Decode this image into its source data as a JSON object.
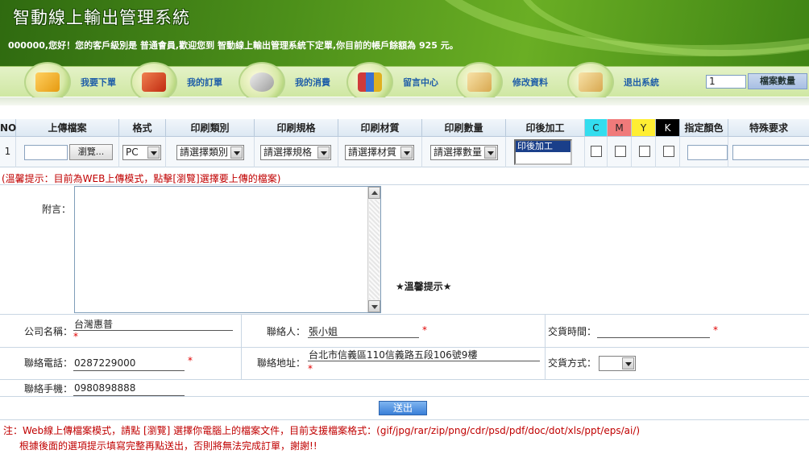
{
  "header": {
    "title": "智動線上輸出管理系統",
    "welcome": "000000,您好！您的客戶級別是 普通會員,歡迎您到 智動線上輸出管理系統下定單,你目前的帳戶餘額為 925 元。"
  },
  "nav": {
    "items": [
      {
        "label": "我要下單",
        "icon": "folder-icon",
        "color": "#f0b030"
      },
      {
        "label": "我的訂單",
        "icon": "orders-icon",
        "color": "#e0552a"
      },
      {
        "label": "我的消費",
        "icon": "gear-folder-icon",
        "color": "#c8c8c8"
      },
      {
        "label": "留言中心",
        "icon": "books-icon",
        "color": "#d04040"
      },
      {
        "label": "修改資料",
        "icon": "edit-folder-icon",
        "color": "#e8c878"
      },
      {
        "label": "退出系統",
        "icon": "exit-folder-icon",
        "color": "#e8c878"
      }
    ],
    "file_count_value": "1",
    "file_count_label": "檔案數量"
  },
  "order_table": {
    "headers": [
      "NO",
      "上傳檔案",
      "格式",
      "印刷類別",
      "印刷規格",
      "印刷材質",
      "印刷數量",
      "印後加工",
      "C",
      "M",
      "Y",
      "K",
      "指定顏色",
      "特殊要求"
    ],
    "cmyk_colors": {
      "C": "#33ddee",
      "M": "#f07a7a",
      "Y": "#ffee33",
      "K": "#000000"
    },
    "row": {
      "no": "1",
      "browse_label": "瀏覽...",
      "format": "PC",
      "category": "請選擇類別",
      "spec": "請選擇規格",
      "material": "請選擇材質",
      "quantity": "請選擇數量",
      "post_process": "印後加工"
    }
  },
  "upload_tip": "(溫馨提示：目前為WEB上傳模式，點擊[瀏覽]選擇要上傳的檔案)",
  "message": {
    "label": "附言：",
    "warm_tip": "★溫馨提示★"
  },
  "contact": {
    "company_label": "公司名稱：",
    "company_value": "台灣惠普",
    "contact_label": "聯絡人：",
    "contact_value": "張小姐",
    "delivery_time_label": "交貨時間：",
    "delivery_time_value": "",
    "phone_label": "聯絡電話：",
    "phone_value": "0287229000",
    "address_label": "聯絡地址：",
    "address_value": "台北市信義區110信義路五段106號9樓",
    "delivery_method_label": "交貨方式：",
    "mobile_label": "聯絡手機：",
    "mobile_value": "0980898888",
    "required_mark": "*"
  },
  "submit_label": "送出",
  "notes": {
    "line1": "注：Web線上傳檔案模式，請點 [瀏覽] 選擇你電腦上的檔案文件，目前支援檔案格式：(gif/jpg/rar/zip/png/cdr/psd/pdf/doc/dot/xls/ppt/eps/ai/)",
    "line2": "根據後面的選項提示填寫完整再點送出，否則將無法完成訂單，謝謝!!"
  }
}
